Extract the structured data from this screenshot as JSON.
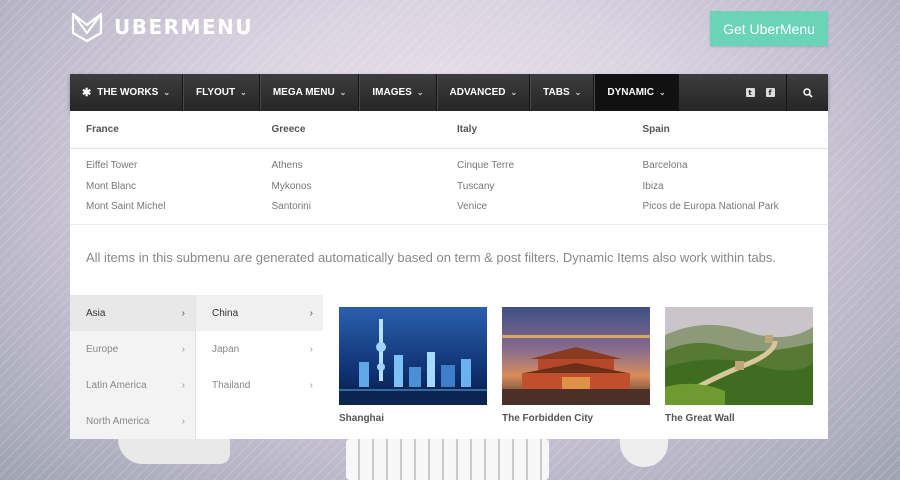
{
  "brand": {
    "name": "UBERMENU"
  },
  "cta": {
    "label": "Get UberMenu"
  },
  "nav": {
    "items": [
      {
        "label": "THE WORKS"
      },
      {
        "label": "FLYOUT"
      },
      {
        "label": "MEGA MENU"
      },
      {
        "label": "IMAGES"
      },
      {
        "label": "ADVANCED"
      },
      {
        "label": "TABS"
      },
      {
        "label": "DYNAMIC"
      }
    ],
    "icons": [
      "twitter-icon",
      "facebook-icon",
      "search-icon"
    ],
    "active": "DYNAMIC"
  },
  "columns": [
    {
      "title": "France",
      "items": [
        "Eiffel Tower",
        "Mont Blanc",
        "Mont Saint Michel"
      ]
    },
    {
      "title": "Greece",
      "items": [
        "Athens",
        "Mykonos",
        "Santorini"
      ]
    },
    {
      "title": "Italy",
      "items": [
        "Cinque Terre",
        "Tuscany",
        "Venice"
      ]
    },
    {
      "title": "Spain",
      "items": [
        "Barcelona",
        "Ibiza",
        "Picos de Europa National Park"
      ]
    }
  ],
  "note": "All items in this submenu are generated automatically based on term & post filters. Dynamic Items also work within tabs.",
  "regions": [
    "Asia",
    "Europe",
    "Latin America",
    "North America"
  ],
  "countries": [
    "China",
    "Japan",
    "Thailand"
  ],
  "cards": [
    {
      "label": "Shanghai"
    },
    {
      "label": "The Forbidden City"
    },
    {
      "label": "The Great Wall"
    }
  ],
  "colors": {
    "accent": "#6ad4b8",
    "menubar": "#2e2e2e"
  }
}
